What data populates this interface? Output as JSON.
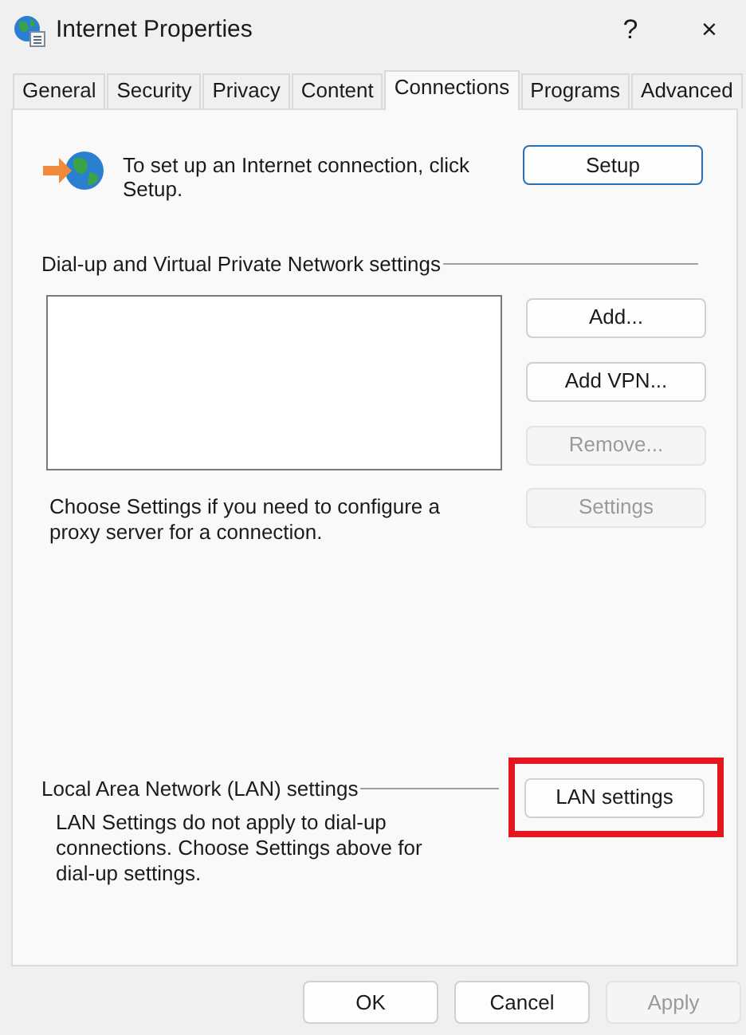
{
  "window": {
    "title": "Internet Properties",
    "help": "?",
    "close": "×"
  },
  "tabs": [
    {
      "label": "General",
      "selected": false
    },
    {
      "label": "Security",
      "selected": false
    },
    {
      "label": "Privacy",
      "selected": false
    },
    {
      "label": "Content",
      "selected": false
    },
    {
      "label": "Connections",
      "selected": true
    },
    {
      "label": "Programs",
      "selected": false
    },
    {
      "label": "Advanced",
      "selected": false
    }
  ],
  "setup": {
    "text": "To set up an Internet connection, click Setup.",
    "button": {
      "label": "Setup",
      "disabled": false
    }
  },
  "dialup": {
    "heading": "Dial-up and Virtual Private Network settings",
    "buttons": [
      {
        "label": "Add...",
        "disabled": false
      },
      {
        "label": "Add VPN...",
        "disabled": false
      },
      {
        "label": "Remove...",
        "disabled": true
      }
    ],
    "proxy_text": "Choose Settings if you need to configure a proxy server for a connection.",
    "settings_button": {
      "label": "Settings",
      "disabled": true
    }
  },
  "lan": {
    "heading": "Local Area Network (LAN) settings",
    "text": "LAN Settings do not apply to dial-up connections. Choose Settings above for dial-up settings.",
    "button": {
      "label": "LAN settings",
      "disabled": false,
      "highlighted": true
    }
  },
  "footer_buttons": [
    {
      "label": "OK",
      "disabled": false
    },
    {
      "label": "Cancel",
      "disabled": false
    },
    {
      "label": "Apply",
      "disabled": true
    }
  ]
}
